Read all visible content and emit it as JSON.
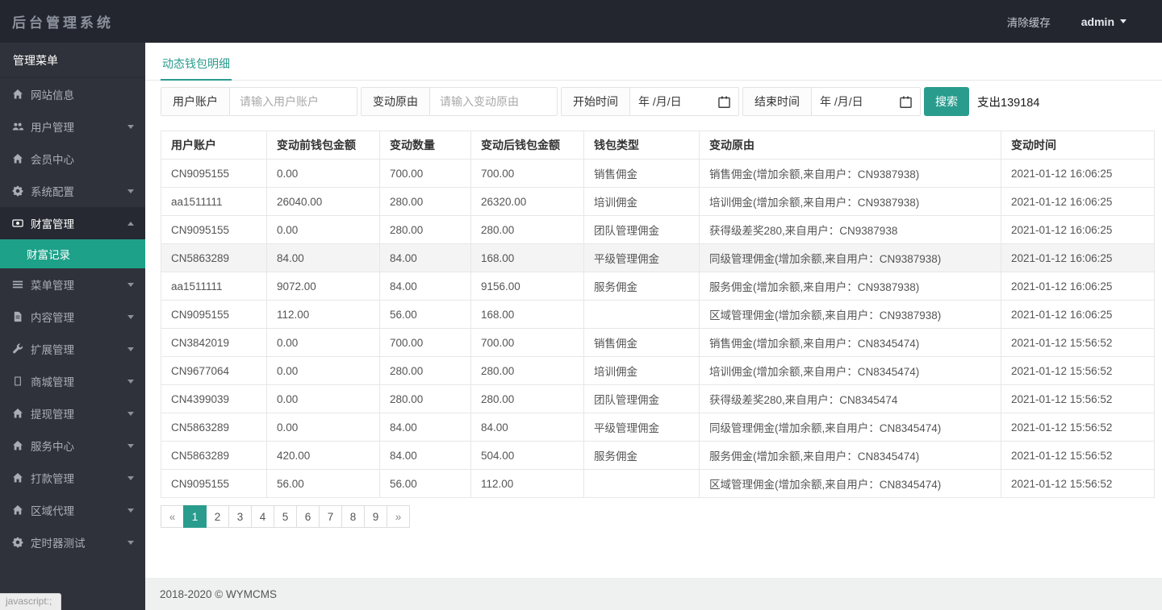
{
  "header": {
    "title": "后台管理系统",
    "clear_cache_label": "清除缓存",
    "username": "admin"
  },
  "sidebar": {
    "menu_title": "管理菜单",
    "items": [
      {
        "key": "site-info",
        "label": "网站信息",
        "icon": "home-icon",
        "caret": null
      },
      {
        "key": "user-mgmt",
        "label": "用户管理",
        "icon": "users-icon",
        "caret": "down"
      },
      {
        "key": "member-center",
        "label": "会员中心",
        "icon": "home-icon",
        "caret": null
      },
      {
        "key": "system-config",
        "label": "系统配置",
        "icon": "cogs-icon",
        "caret": "down"
      },
      {
        "key": "wealth-mgmt",
        "label": "财富管理",
        "icon": "money-icon",
        "caret": "up",
        "expanded": true,
        "children": [
          {
            "key": "wealth-record",
            "label": "财富记录",
            "active": true
          }
        ]
      },
      {
        "key": "menu-mgmt",
        "label": "菜单管理",
        "icon": "list-icon",
        "caret": "down"
      },
      {
        "key": "content-mgmt",
        "label": "内容管理",
        "icon": "file-icon",
        "caret": "down"
      },
      {
        "key": "extension-mgmt",
        "label": "扩展管理",
        "icon": "wrench-icon",
        "caret": "down"
      },
      {
        "key": "mall-mgmt",
        "label": "商城管理",
        "icon": "box-icon",
        "caret": "down"
      },
      {
        "key": "withdraw-mgmt",
        "label": "提现管理",
        "icon": "home-icon",
        "caret": "down"
      },
      {
        "key": "service-center",
        "label": "服务中心",
        "icon": "home-icon",
        "caret": "down"
      },
      {
        "key": "payout-mgmt",
        "label": "打款管理",
        "icon": "home-icon",
        "caret": "down"
      },
      {
        "key": "region-agent",
        "label": "区域代理",
        "icon": "home-icon",
        "caret": "down"
      },
      {
        "key": "timer-test",
        "label": "定时器测试",
        "icon": "cogs-icon",
        "caret": "down"
      }
    ]
  },
  "main": {
    "tab_label": "动态钱包明细",
    "filters": {
      "user_label": "用户账户",
      "user_placeholder": "请输入用户账户",
      "reason_label": "变动原由",
      "reason_placeholder": "请输入变动原由",
      "start_label": "开始时间",
      "end_label": "结束时间",
      "date_placeholder": "年 /月/日",
      "search_label": "搜索",
      "summary": "支出139184"
    },
    "table": {
      "headers": [
        "用户账户",
        "变动前钱包金额",
        "变动数量",
        "变动后钱包金额",
        "钱包类型",
        "变动原由",
        "变动时间"
      ],
      "highlighted_row": 3,
      "rows": [
        [
          "CN9095155",
          "0.00",
          "700.00",
          "700.00",
          "销售佣金",
          "销售佣金(增加余额,来自用户：CN9387938)",
          "2021-01-12 16:06:25"
        ],
        [
          "aa1511111",
          "26040.00",
          "280.00",
          "26320.00",
          "培训佣金",
          "培训佣金(增加余额,来自用户：CN9387938)",
          "2021-01-12 16:06:25"
        ],
        [
          "CN9095155",
          "0.00",
          "280.00",
          "280.00",
          "团队管理佣金",
          "获得级差奖280,来自用户：CN9387938",
          "2021-01-12 16:06:25"
        ],
        [
          "CN5863289",
          "84.00",
          "84.00",
          "168.00",
          "平级管理佣金",
          "同级管理佣金(增加余额,来自用户：CN9387938)",
          "2021-01-12 16:06:25"
        ],
        [
          "aa1511111",
          "9072.00",
          "84.00",
          "9156.00",
          "服务佣金",
          "服务佣金(增加余额,来自用户：CN9387938)",
          "2021-01-12 16:06:25"
        ],
        [
          "CN9095155",
          "112.00",
          "56.00",
          "168.00",
          "",
          "区域管理佣金(增加余额,来自用户：CN9387938)",
          "2021-01-12 16:06:25"
        ],
        [
          "CN3842019",
          "0.00",
          "700.00",
          "700.00",
          "销售佣金",
          "销售佣金(增加余额,来自用户：CN8345474)",
          "2021-01-12 15:56:52"
        ],
        [
          "CN9677064",
          "0.00",
          "280.00",
          "280.00",
          "培训佣金",
          "培训佣金(增加余额,来自用户：CN8345474)",
          "2021-01-12 15:56:52"
        ],
        [
          "CN4399039",
          "0.00",
          "280.00",
          "280.00",
          "团队管理佣金",
          "获得级差奖280,来自用户：CN8345474",
          "2021-01-12 15:56:52"
        ],
        [
          "CN5863289",
          "0.00",
          "84.00",
          "84.00",
          "平级管理佣金",
          "同级管理佣金(增加余额,来自用户：CN8345474)",
          "2021-01-12 15:56:52"
        ],
        [
          "CN5863289",
          "420.00",
          "84.00",
          "504.00",
          "服务佣金",
          "服务佣金(增加余额,来自用户：CN8345474)",
          "2021-01-12 15:56:52"
        ],
        [
          "CN9095155",
          "56.00",
          "56.00",
          "112.00",
          "",
          "区域管理佣金(增加余额,来自用户：CN8345474)",
          "2021-01-12 15:56:52"
        ]
      ]
    },
    "pagination": {
      "prev": "«",
      "pages": [
        "1",
        "2",
        "3",
        "4",
        "5",
        "6",
        "7",
        "8",
        "9"
      ],
      "next": "»",
      "active": "1"
    },
    "footer_text": "2018-2020 © WYMCMS"
  },
  "status_tooltip": "javascript:;",
  "colors": {
    "accent": "#2a9c8e",
    "topbar_bg": "#23262e",
    "sidebar_bg": "#2f323a",
    "sidebar_expanded_bg": "#262932",
    "sidebar_active_bg": "#1da189"
  }
}
